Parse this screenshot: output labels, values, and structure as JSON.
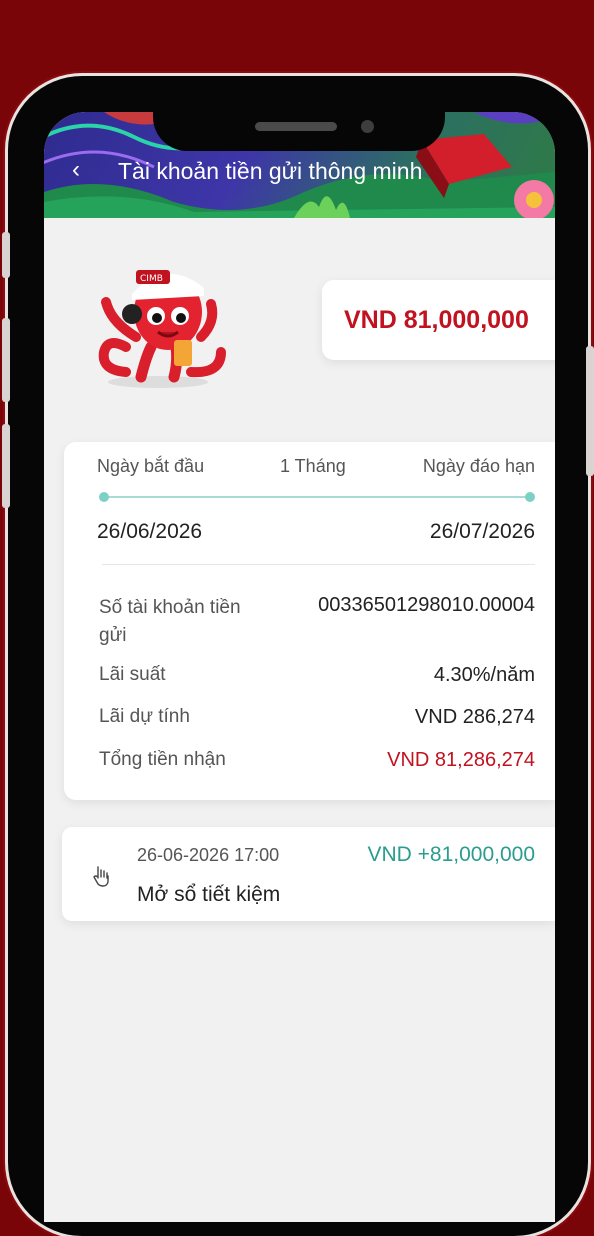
{
  "header": {
    "back_icon": "chevron-left-icon",
    "title": "Tài khoản tiền gửi thông minh"
  },
  "balance": {
    "amount": "VND 81,000,000",
    "color": "#c1121f"
  },
  "mascot": {
    "badge_text": "CIMB"
  },
  "term": {
    "start_label": "Ngày bắt đầu",
    "duration_label": "1 Tháng",
    "end_label": "Ngày đáo hạn",
    "start_date": "26/06/2026",
    "end_date": "26/07/2026"
  },
  "details": [
    {
      "label": "Số tài khoản tiền gửi",
      "value": "00336501298010.00004"
    },
    {
      "label": "Lãi suất",
      "value": "4.30%/năm"
    },
    {
      "label": "Lãi dự tính",
      "value": "VND 286,274"
    },
    {
      "label": "Tổng tiền nhận",
      "value": "VND 81,286,274"
    }
  ],
  "transaction": {
    "icon": "hand-pointer-icon",
    "time": "26-06-2026 17:00",
    "amount": "VND +81,000,000",
    "description": "Mở sổ tiết kiệm",
    "amount_color": "#2a9d8f"
  }
}
